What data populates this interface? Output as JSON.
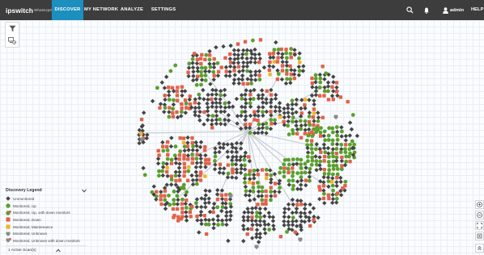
{
  "app": {
    "brand_name": "ipswitch",
    "brand_product": "WhatsUpGold"
  },
  "nav": {
    "tabs": [
      {
        "label": "DISCOVER",
        "active": true
      },
      {
        "label": "MY NETWORK",
        "active": false
      },
      {
        "label": "ANALYZE",
        "active": false
      },
      {
        "label": "SETTINGS",
        "active": false
      }
    ],
    "user_label": "admin",
    "help_label": "HELP"
  },
  "colors": {
    "topbar": "#3d3d3d",
    "active_tab": "#1c8fbf",
    "unmonitored": "#444444",
    "up": "#5aa02c",
    "up_down_monitors": "#5aa02c",
    "down": "#e2624a",
    "maintenance": "#f0b428",
    "unknown": "#8a8a8a",
    "unknown_down": "#8a8a8a"
  },
  "toolbar": {
    "filter_icon": "filter-icon",
    "layout_icon": "device-layout-icon"
  },
  "legend": {
    "title": "Discovery Legend",
    "items": [
      {
        "label": "Unmonitored",
        "shape": "diamond",
        "color": "#444444"
      },
      {
        "label": "Monitored, Up",
        "shape": "circle",
        "color": "#5aa02c"
      },
      {
        "label": "Monitored, Up, with down monitors",
        "shape": "circle-flag",
        "color": "#5aa02c"
      },
      {
        "label": "Monitored, Down",
        "shape": "square",
        "color": "#e2624a"
      },
      {
        "label": "Monitored, Maintenance",
        "shape": "square",
        "color": "#f0b428"
      },
      {
        "label": "Monitored, Unknown",
        "shape": "shield",
        "color": "#8a8a8a"
      },
      {
        "label": "Monitored, Unknown with down monitors",
        "shape": "shield-flag",
        "color": "#8a8a8a"
      }
    ]
  },
  "scan": {
    "label": "1 Active Scan(s)"
  },
  "zoom_controls": [
    "zoom-in-icon",
    "zoom-out-icon",
    "fit-to-screen-icon",
    "reset-view-icon",
    "expand-panel-icon"
  ]
}
